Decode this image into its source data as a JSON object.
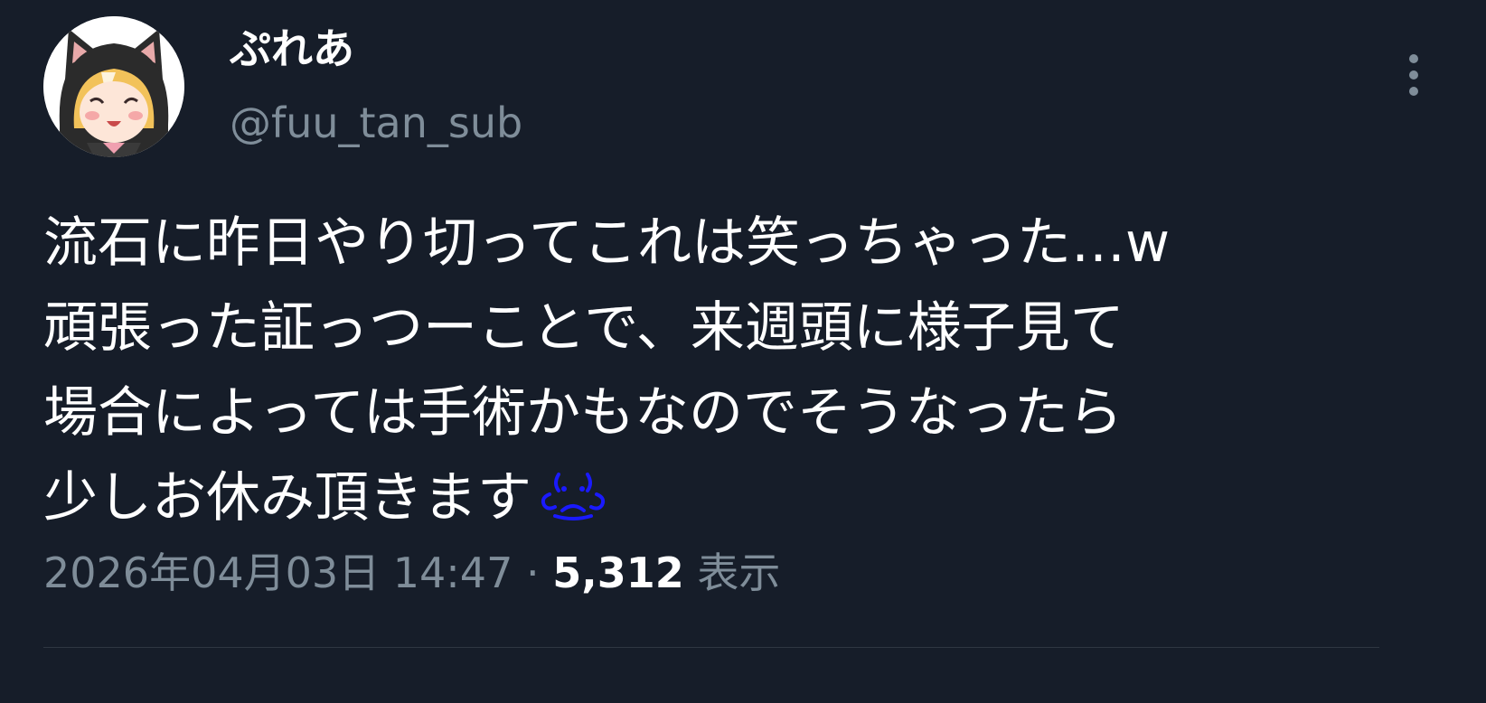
{
  "tweet": {
    "display_name": "ぷれあ",
    "handle": "@fuu_tan_sub",
    "text_lines": [
      "流石に昨日やり切ってこれは笑っちゃった…w",
      "頑張った証っつーことで、来週頭に様子見て",
      "場合によっては手術かもなのでそうなったら",
      "少しお休み頂きます"
    ],
    "emoji": "crying-face-emoji",
    "date": "2026年04月03日",
    "time": "14:47",
    "separator": "·",
    "views_count": "5,312",
    "views_label": "表示"
  },
  "colors": {
    "background": "#161d29",
    "text_primary": "#ffffff",
    "text_secondary": "#7f8d99",
    "divider": "#2f3742",
    "emoji": "#1a1aff"
  },
  "icons": {
    "more": "more-vertical-icon"
  }
}
